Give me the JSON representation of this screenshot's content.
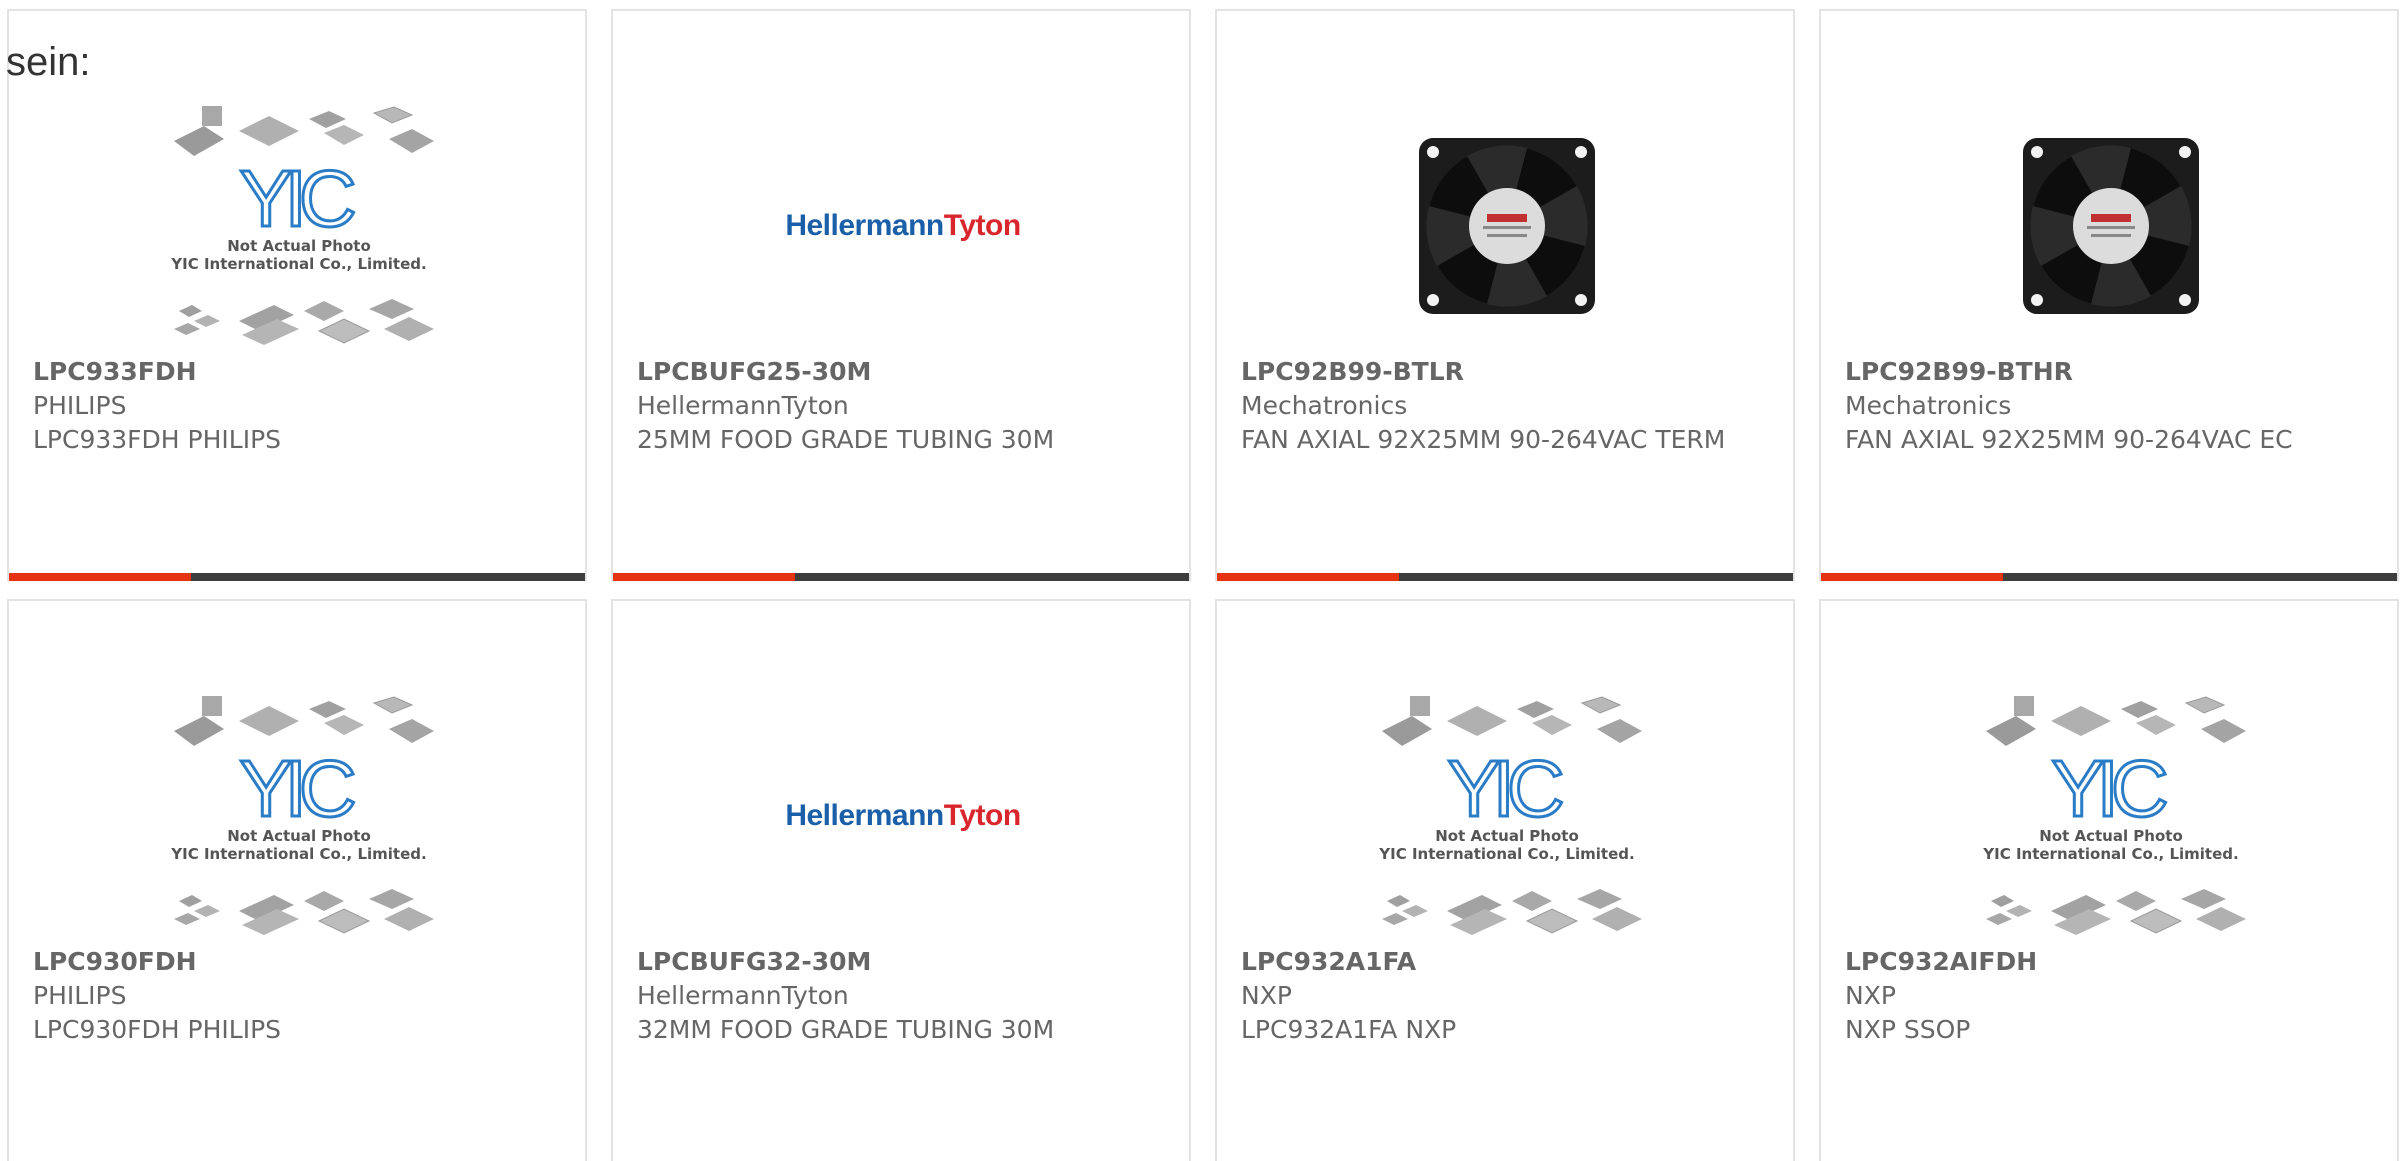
{
  "intro_text": "sein:",
  "accent_color": "#e63312",
  "bar_color": "#3d3d3d",
  "placeholder_image": {
    "caption_line1": "Not Actual Photo",
    "caption_line2": "YIC International Co., Limited.",
    "logo_letters": "YIC"
  },
  "brand_logo": {
    "part1": "Hellermann",
    "part2": "Tyton",
    "color1": "#1a5fa8",
    "color2": "#d9262c"
  },
  "products": [
    {
      "part_number": "LPC933FDH",
      "manufacturer": "PHILIPS",
      "description": "LPC933FDH PHILIPS",
      "image": "yic-placeholder"
    },
    {
      "part_number": "LPCBUFG25-30M",
      "manufacturer": "HellermannTyton",
      "description": "25MM FOOD GRADE TUBING 30M",
      "image": "hellermanntyton-logo"
    },
    {
      "part_number": "LPC92B99-BTLR",
      "manufacturer": "Mechatronics",
      "description": "FAN AXIAL 92X25MM 90-264VAC TERM",
      "image": "axial-fan-photo"
    },
    {
      "part_number": "LPC92B99-BTHR",
      "manufacturer": "Mechatronics",
      "description": "FAN AXIAL 92X25MM 90-264VAC EC",
      "image": "axial-fan-photo"
    },
    {
      "part_number": "LPC930FDH",
      "manufacturer": "PHILIPS",
      "description": "LPC930FDH PHILIPS",
      "image": "yic-placeholder"
    },
    {
      "part_number": "LPCBUFG32-30M",
      "manufacturer": "HellermannTyton",
      "description": "32MM FOOD GRADE TUBING 30M",
      "image": "hellermanntyton-logo"
    },
    {
      "part_number": "LPC932A1FA",
      "manufacturer": "NXP",
      "description": "LPC932A1FA NXP",
      "image": "yic-placeholder"
    },
    {
      "part_number": "LPC932AIFDH",
      "manufacturer": "NXP",
      "description": "NXP SSOP",
      "image": "yic-placeholder"
    }
  ]
}
